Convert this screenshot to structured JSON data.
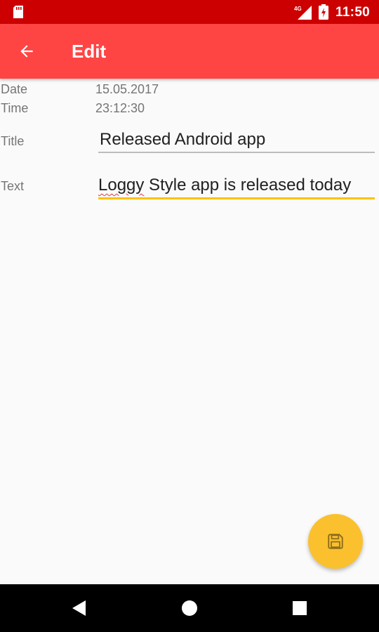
{
  "status_bar": {
    "network_label": "4G",
    "time": "11:50",
    "icons": [
      "sd-card-icon",
      "signal-icon",
      "battery-icon"
    ]
  },
  "app_bar": {
    "title": "Edit",
    "back_icon": "arrow-back-icon",
    "color": "#ff4444"
  },
  "form": {
    "date_label": "Date",
    "date_value": "15.05.2017",
    "time_label": "Time",
    "time_value": "23:12:30",
    "title_label": "Title",
    "title_value": "Released Android app",
    "text_label": "Text",
    "text_value_misspelled": "Loggy",
    "text_value_rest": " Style app is released today"
  },
  "fab": {
    "icon": "save-icon",
    "color": "#fbc02d"
  },
  "colors": {
    "status_bar": "#cc0000",
    "accent": "#ffc107",
    "spell_error": "#e53935"
  },
  "nav_bar": {
    "icons": [
      "nav-back-icon",
      "nav-home-icon",
      "nav-recents-icon"
    ]
  }
}
